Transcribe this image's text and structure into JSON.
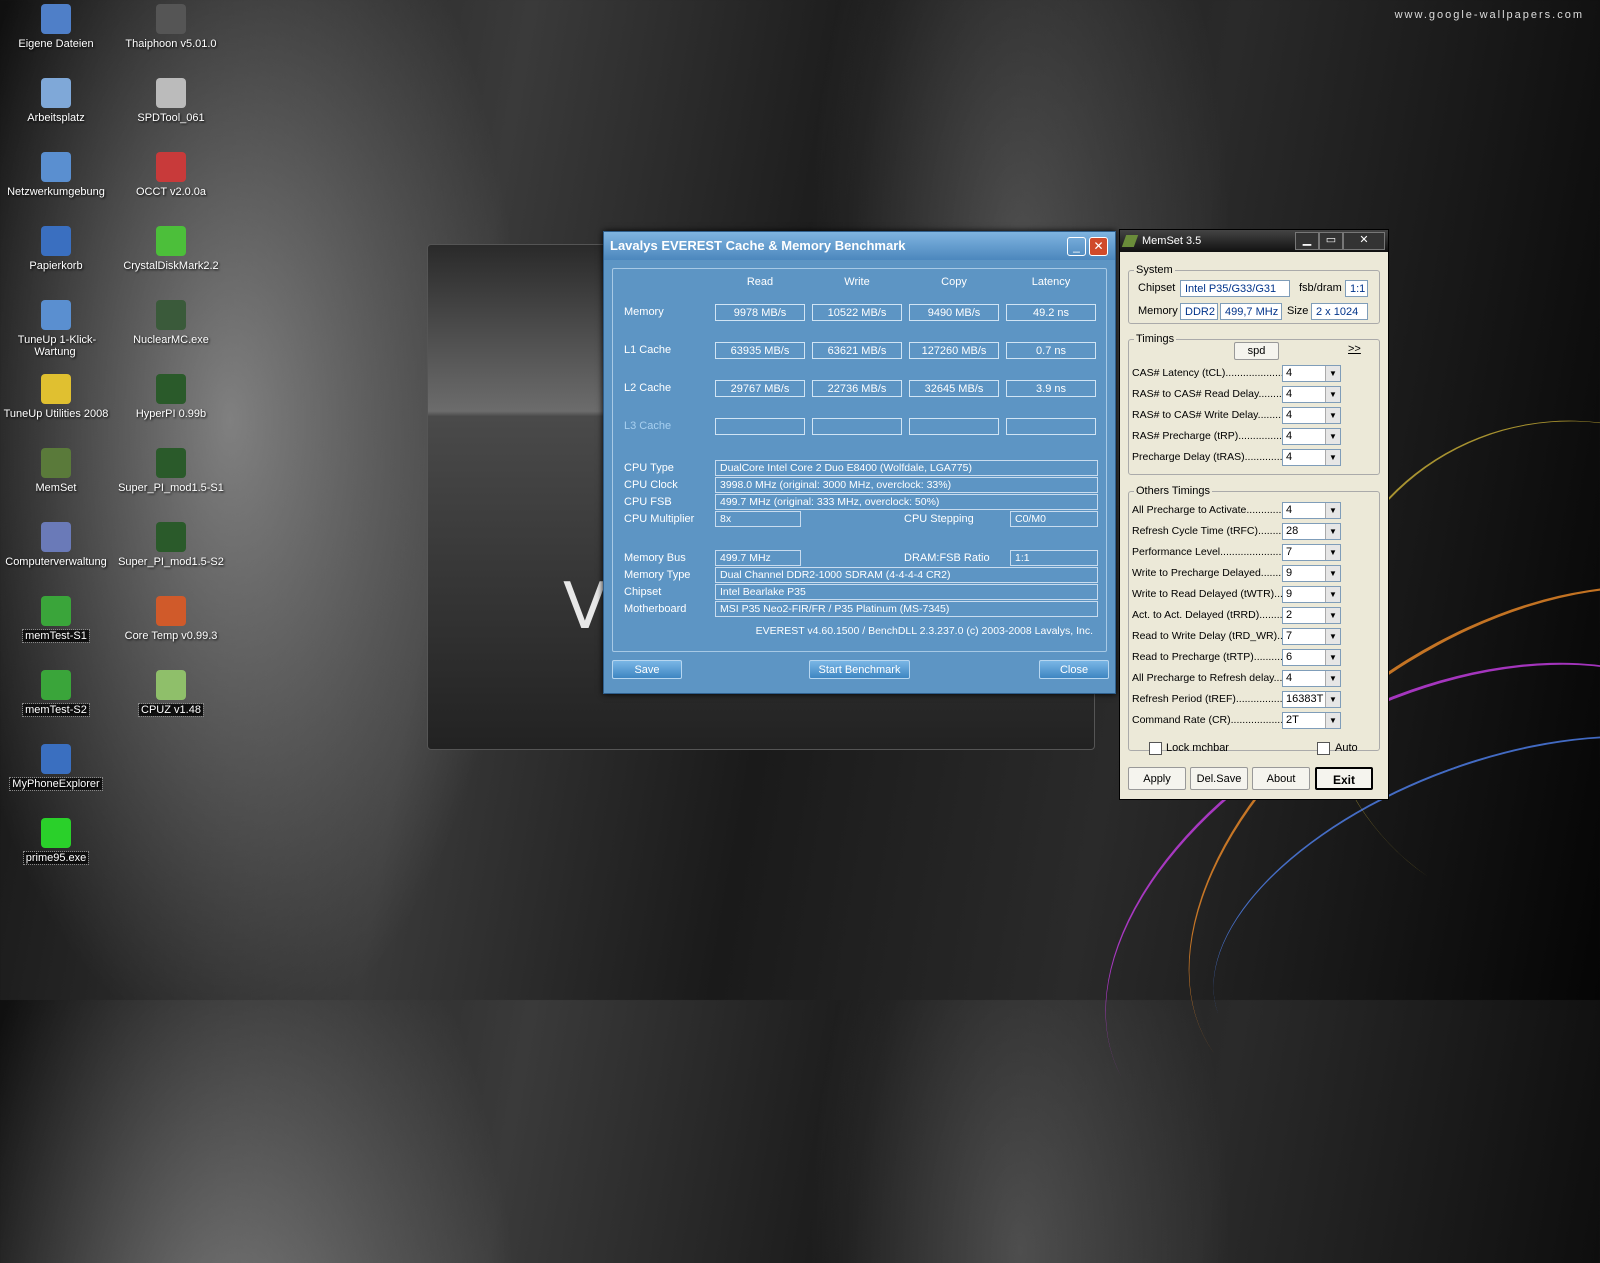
{
  "watermark": "www.google-wallpapers.com",
  "desktop": {
    "icons": [
      {
        "label": "Eigene Dateien",
        "color": "#4f7fc8"
      },
      {
        "label": "Thaiphoon v5.01.0",
        "color": "#555"
      },
      {
        "label": "Arbeitsplatz",
        "color": "#7fa8d8"
      },
      {
        "label": "SPDTool_061",
        "color": "#bbb"
      },
      {
        "label": "Netzwerkumgebung",
        "color": "#5a8fd0"
      },
      {
        "label": "OCCT v2.0.0a",
        "color": "#c83a3a"
      },
      {
        "label": "Papierkorb",
        "color": "#3a6fc0"
      },
      {
        "label": "CrystalDiskMark2.2",
        "color": "#4cbf3a"
      },
      {
        "label": "TuneUp 1-Klick-Wartung",
        "color": "#5a8fd0"
      },
      {
        "label": "NuclearMC.exe",
        "color": "#3a5a3a"
      },
      {
        "label": "TuneUp Utilities 2008",
        "color": "#e0c030"
      },
      {
        "label": "HyperPI 0.99b",
        "color": "#2a5a2a"
      },
      {
        "label": "MemSet",
        "color": "#5a7a3a"
      },
      {
        "label": "Super_PI_mod1.5-S1",
        "color": "#2a5a2a"
      },
      {
        "label": "Computerverwaltung",
        "color": "#6a7ab8"
      },
      {
        "label": "Super_PI_mod1.5-S2",
        "color": "#2a5a2a"
      },
      {
        "label": "memTest-S1",
        "color": "#3aa53a"
      },
      {
        "label": "Core Temp v0.99.3",
        "color": "#d05a2a"
      },
      {
        "label": "memTest-S2",
        "color": "#3aa53a"
      },
      {
        "label": "CPUZ v1.48",
        "color": "#8fbf6a"
      },
      {
        "label": "MyPhoneExplorer",
        "color": "#3a6fc0"
      },
      {
        "label": "prime95.exe",
        "color": "#2ad02a"
      }
    ]
  },
  "bgwin": {
    "big_letter": "V"
  },
  "everest": {
    "title": "Lavalys EVEREST Cache & Memory Benchmark",
    "headers": [
      "Read",
      "Write",
      "Copy",
      "Latency"
    ],
    "rows": [
      {
        "label": "Memory",
        "values": [
          "9978 MB/s",
          "10522 MB/s",
          "9490 MB/s",
          "49.2 ns"
        ]
      },
      {
        "label": "L1 Cache",
        "values": [
          "63935 MB/s",
          "63621 MB/s",
          "127260 MB/s",
          "0.7 ns"
        ]
      },
      {
        "label": "L2 Cache",
        "values": [
          "29767 MB/s",
          "22736 MB/s",
          "32645 MB/s",
          "3.9 ns"
        ]
      },
      {
        "label": "L3 Cache",
        "values": [
          "",
          "",
          "",
          ""
        ]
      }
    ],
    "info": {
      "cpu_type_label": "CPU Type",
      "cpu_type": "DualCore Intel Core 2 Duo E8400  (Wolfdale, LGA775)",
      "cpu_clock_label": "CPU Clock",
      "cpu_clock": "3998.0 MHz  (original: 3000 MHz, overclock: 33%)",
      "cpu_fsb_label": "CPU FSB",
      "cpu_fsb": "499.7 MHz  (original: 333 MHz, overclock: 50%)",
      "cpu_mult_label": "CPU Multiplier",
      "cpu_mult": "8x",
      "cpu_step_label": "CPU Stepping",
      "cpu_step": "C0/M0",
      "mem_bus_label": "Memory Bus",
      "mem_bus": "499.7 MHz",
      "ratio_label": "DRAM:FSB Ratio",
      "ratio": "1:1",
      "mem_type_label": "Memory Type",
      "mem_type": "Dual Channel DDR2-1000 SDRAM  (4-4-4-4 CR2)",
      "chipset_label": "Chipset",
      "chipset": "Intel Bearlake P35",
      "mobo_label": "Motherboard",
      "mobo": "MSI P35 Neo2-FIR/FR / P35 Platinum (MS-7345)"
    },
    "version": "EVEREST v4.60.1500 / BenchDLL 2.3.237.0  (c) 2003-2008 Lavalys, Inc.",
    "buttons": {
      "save": "Save",
      "start": "Start Benchmark",
      "close": "Close"
    }
  },
  "memset": {
    "title": "MemSet 3.5",
    "system_label": "System",
    "chipset_label": "Chipset",
    "chipset": "Intel P35/G33/G31",
    "fsb_label": "fsb/dram",
    "fsb": "1:1",
    "memory_label": "Memory",
    "mem_type": "DDR2",
    "mem_freq": "499,7 MHz",
    "size_label": "Size",
    "size": "2 x 1024",
    "timings_label": "Timings",
    "spd": "spd",
    "more": ">>",
    "timings": [
      {
        "label": "CAS# Latency (tCL)............................",
        "value": "4"
      },
      {
        "label": "RAS# to CAS# Read Delay..........................",
        "value": "4"
      },
      {
        "label": "RAS# to CAS# Write Delay..........................",
        "value": "4"
      },
      {
        "label": "RAS# Precharge (tRP)............................",
        "value": "4"
      },
      {
        "label": "Precharge Delay  (tRAS)..........................",
        "value": "4"
      }
    ],
    "others_label": "Others Timings",
    "others": [
      {
        "label": "All Precharge to Activate............................",
        "value": "4"
      },
      {
        "label": "Refresh Cycle Time (tRFC)............................",
        "value": "28"
      },
      {
        "label": "Performance Level............................",
        "value": "7"
      },
      {
        "label": "Write to Precharge Delayed............................",
        "value": "9"
      },
      {
        "label": "Write to Read Delayed (tWTR)............................",
        "value": "9"
      },
      {
        "label": "Act. to Act. Delayed (tRRD)............................",
        "value": "2"
      },
      {
        "label": "Read to Write Delay (tRD_WR)............................",
        "value": "7"
      },
      {
        "label": "Read to Precharge (tRTP)............................",
        "value": "6"
      },
      {
        "label": "All Precharge to Refresh delay............................",
        "value": "4"
      },
      {
        "label": "Refresh Period (tREF)............................",
        "value": "16383T"
      },
      {
        "label": "Command Rate (CR)............................",
        "value": "2T"
      }
    ],
    "lock_label": "Lock mchbar",
    "auto_label": "Auto",
    "buttons": {
      "apply": "Apply",
      "delsave": "Del.Save",
      "about": "About",
      "exit": "Exit"
    }
  }
}
